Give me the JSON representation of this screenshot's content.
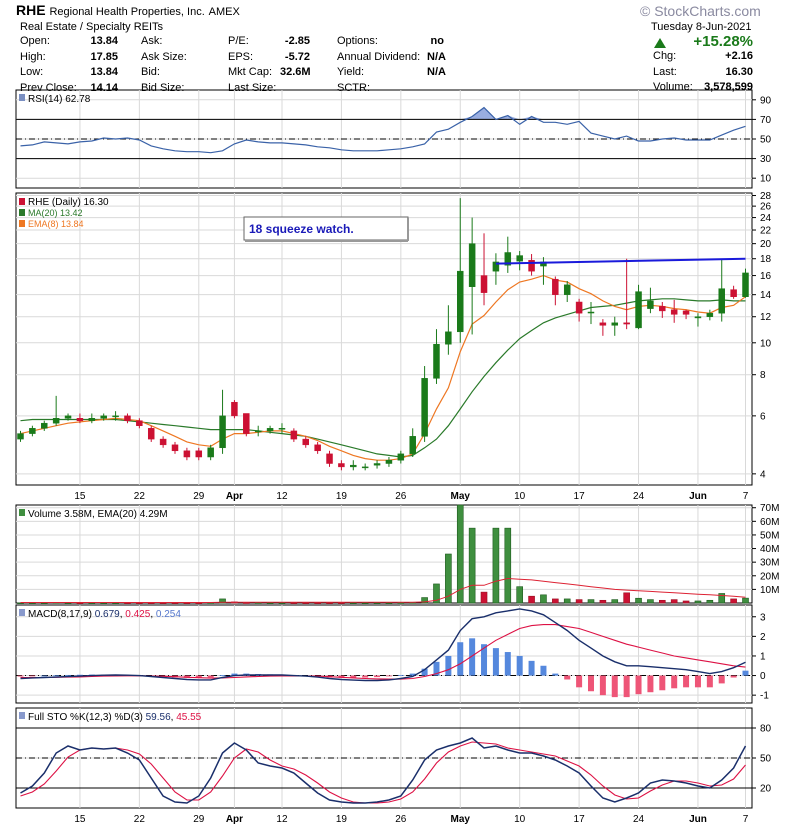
{
  "header": {
    "symbol": "RHE",
    "company": "Regional Health Properties, Inc.",
    "exchange": "AMEX",
    "sector": "Real Estate / Specialty REITs",
    "date": "Tuesday  8-Jun-2021",
    "watermark": "© StockCharts.com",
    "pct_change": "+15.28%",
    "rows_left": [
      {
        "label": "Open:",
        "value": "13.84"
      },
      {
        "label": "High:",
        "value": "17.85"
      },
      {
        "label": "Low:",
        "value": "13.84"
      },
      {
        "label": "Prev Close:",
        "value": "14.14"
      }
    ],
    "rows_mid1": [
      {
        "label": "Ask:",
        "value": ""
      },
      {
        "label": "Ask Size:",
        "value": ""
      },
      {
        "label": "Bid:",
        "value": ""
      },
      {
        "label": "Bid Size:",
        "value": ""
      }
    ],
    "rows_mid2": [
      {
        "label": "P/E:",
        "value": "-2.85"
      },
      {
        "label": "EPS:",
        "value": "-5.72"
      },
      {
        "label": "Mkt Cap:",
        "value": "32.6M"
      },
      {
        "label": "Last Size:",
        "value": ""
      }
    ],
    "rows_mid3": [
      {
        "label": "Options:",
        "value": "no"
      },
      {
        "label": "Annual Dividend:",
        "value": "N/A"
      },
      {
        "label": "Yield:",
        "value": "N/A"
      },
      {
        "label": "SCTR:",
        "value": ""
      }
    ],
    "rows_right": [
      {
        "label": "Chg:",
        "value": "+2.16"
      },
      {
        "label": "Last:",
        "value": "16.30"
      },
      {
        "label": "Volume:",
        "value": "3,578,599"
      }
    ]
  },
  "chart_data": {
    "type": "candlestick",
    "x_labels": [
      {
        "i": 5,
        "text": "15"
      },
      {
        "i": 10,
        "text": "22"
      },
      {
        "i": 15,
        "text": "29"
      },
      {
        "i": 18,
        "text": "Apr"
      },
      {
        "i": 22,
        "text": "12"
      },
      {
        "i": 27,
        "text": "19"
      },
      {
        "i": 32,
        "text": "26"
      },
      {
        "i": 37,
        "text": "May"
      },
      {
        "i": 42,
        "text": "10"
      },
      {
        "i": 47,
        "text": "17"
      },
      {
        "i": 52,
        "text": "24"
      },
      {
        "i": 57,
        "text": "Jun"
      },
      {
        "i": 61,
        "text": "7"
      }
    ],
    "colors": {
      "up": "#1a7a1a",
      "down": "#cc1133",
      "ma": "#2a7a2a",
      "ema": "#ee7722",
      "rsi": "#3a62a8",
      "macd": "#1a2f6b",
      "signal": "#dd1144",
      "hist": "#5588dd",
      "trend": "#1a1adb",
      "vol": "#3f8f3f",
      "vol_ema": "#dd2233"
    },
    "rsi": {
      "legend": "RSI(14)",
      "legend_value": "62.78",
      "ylim": [
        0,
        100
      ],
      "ticks": [
        10,
        30,
        50,
        70,
        90
      ],
      "levels": [
        30,
        50,
        70
      ],
      "values": [
        43,
        44,
        47,
        46,
        45,
        47,
        48,
        51,
        50,
        51,
        49,
        43,
        40,
        38,
        37,
        37,
        36,
        38,
        45,
        49,
        47,
        46,
        46,
        45,
        44,
        42,
        41,
        39,
        38,
        38,
        38,
        39,
        40,
        42,
        45,
        57,
        60,
        67,
        73,
        82,
        70,
        74,
        65,
        73,
        67,
        67,
        65,
        68,
        56,
        53,
        50,
        53,
        48,
        48,
        50,
        51,
        49,
        49,
        49,
        54,
        59,
        63
      ]
    },
    "price": {
      "legend": "RHE (Daily)",
      "legend_value": "16.30",
      "ma_legend": "MA(20)",
      "ma_value": "13.42",
      "ema_legend": "EMA(8)",
      "ema_value": "13.84",
      "annotation": "18 squeeze watch.",
      "scale": "log",
      "ylim": [
        3.7,
        28.5
      ],
      "ticks": [
        4,
        6,
        8,
        10,
        12,
        14,
        16,
        18,
        20,
        22,
        24,
        26,
        28
      ],
      "trendline": {
        "from": [
          40,
          17.4
        ],
        "to": [
          61,
          18.0
        ]
      },
      "open": [
        5.1,
        5.3,
        5.5,
        5.7,
        5.9,
        5.9,
        5.8,
        5.9,
        6.0,
        6.0,
        5.8,
        5.5,
        5.1,
        4.9,
        4.7,
        4.7,
        4.5,
        4.8,
        6.6,
        6.1,
        5.4,
        5.4,
        5.5,
        5.4,
        5.1,
        4.9,
        4.6,
        4.3,
        4.2,
        4.2,
        4.25,
        4.3,
        4.4,
        4.6,
        5.2,
        7.8,
        9.9,
        10.8,
        14.8,
        16.0,
        16.5,
        17.2,
        17.7,
        17.8,
        17.1,
        15.6,
        14.0,
        13.3,
        12.4,
        11.5,
        11.3,
        11.5,
        11.1,
        12.7,
        12.9,
        12.6,
        12.5,
        11.9,
        12.0,
        12.3,
        14.5,
        13.8
      ],
      "close": [
        5.3,
        5.5,
        5.7,
        5.9,
        6.0,
        5.8,
        5.9,
        6.0,
        6.0,
        5.8,
        5.6,
        5.1,
        4.9,
        4.7,
        4.5,
        4.5,
        4.8,
        6.0,
        6.0,
        5.3,
        5.4,
        5.5,
        5.5,
        5.1,
        4.9,
        4.7,
        4.3,
        4.2,
        4.25,
        4.2,
        4.3,
        4.4,
        4.6,
        5.2,
        7.8,
        9.9,
        10.8,
        16.5,
        20.0,
        14.2,
        17.6,
        18.8,
        18.4,
        16.5,
        17.6,
        14.0,
        15.0,
        12.3,
        12.4,
        11.3,
        11.5,
        11.4,
        14.3,
        13.4,
        12.5,
        12.2,
        12.2,
        12.0,
        12.3,
        14.6,
        13.8,
        16.3
      ],
      "high": [
        5.4,
        5.6,
        5.8,
        6.9,
        6.1,
        6.1,
        6.1,
        6.1,
        6.2,
        6.1,
        5.9,
        5.6,
        5.2,
        5.0,
        4.8,
        4.8,
        4.9,
        7.2,
        6.7,
        6.1,
        5.6,
        5.6,
        5.7,
        5.5,
        5.2,
        5.0,
        4.7,
        4.4,
        4.4,
        4.3,
        4.4,
        4.5,
        4.7,
        5.5,
        8.5,
        11.0,
        13.0,
        27.5,
        24.0,
        21.5,
        18.7,
        21.0,
        19.0,
        18.6,
        18.2,
        15.9,
        15.4,
        13.6,
        13.3,
        11.8,
        12.0,
        18.0,
        15.0,
        14.7,
        13.3,
        13.5,
        12.6,
        12.3,
        12.6,
        18.0,
        14.9,
        16.8
      ],
      "low": [
        5.0,
        5.2,
        5.4,
        5.6,
        5.8,
        5.7,
        5.7,
        5.8,
        5.8,
        5.7,
        5.5,
        5.0,
        4.8,
        4.6,
        4.4,
        4.4,
        4.4,
        4.6,
        5.9,
        5.2,
        5.2,
        5.3,
        5.3,
        5.0,
        4.8,
        4.6,
        4.2,
        4.1,
        4.1,
        4.1,
        4.15,
        4.2,
        4.3,
        4.5,
        5.0,
        7.5,
        9.2,
        10.0,
        10.6,
        13.0,
        15.0,
        16.3,
        16.6,
        16.0,
        15.0,
        13.0,
        13.3,
        11.6,
        11.4,
        10.5,
        10.5,
        11.0,
        11.0,
        12.3,
        11.9,
        11.5,
        11.8,
        11.2,
        11.7,
        11.6,
        13.6,
        13.7
      ],
      "ma20": [
        5.8,
        5.85,
        5.85,
        5.85,
        5.85,
        5.85,
        5.85,
        5.85,
        5.85,
        5.8,
        5.75,
        5.7,
        5.65,
        5.6,
        5.55,
        5.5,
        5.45,
        5.45,
        5.45,
        5.45,
        5.4,
        5.35,
        5.3,
        5.25,
        5.2,
        5.1,
        5.0,
        4.9,
        4.8,
        4.7,
        4.6,
        4.55,
        4.5,
        4.55,
        4.8,
        5.1,
        5.6,
        6.3,
        7.1,
        7.9,
        8.7,
        9.5,
        10.3,
        10.9,
        11.5,
        11.9,
        12.2,
        12.5,
        12.8,
        12.9,
        13.0,
        13.2,
        13.4,
        13.5,
        13.6,
        13.6,
        13.5,
        13.4,
        13.4,
        13.5,
        13.4,
        13.4
      ],
      "ema8": [
        5.3,
        5.4,
        5.5,
        5.6,
        5.7,
        5.75,
        5.8,
        5.85,
        5.9,
        5.85,
        5.8,
        5.6,
        5.4,
        5.2,
        5.0,
        4.9,
        4.85,
        5.1,
        5.3,
        5.3,
        5.35,
        5.4,
        5.4,
        5.3,
        5.2,
        5.05,
        4.85,
        4.7,
        4.55,
        4.45,
        4.4,
        4.4,
        4.45,
        4.6,
        5.3,
        6.3,
        7.3,
        9.4,
        11.4,
        12.1,
        13.3,
        14.5,
        15.3,
        15.6,
        16.0,
        15.5,
        15.3,
        14.6,
        14.1,
        13.4,
        12.9,
        12.6,
        12.9,
        13.0,
        12.9,
        12.7,
        12.6,
        12.4,
        12.3,
        12.8,
        13.0,
        13.8
      ]
    },
    "volume": {
      "legend": "Volume",
      "legend_value": "3.58M",
      "ema_legend": "EMA(20)",
      "ema_value": "4.29M",
      "unit": "M",
      "ylim": [
        0,
        72
      ],
      "ticks": [
        "10M",
        "20M",
        "30M",
        "40M",
        "50M",
        "60M",
        "70M"
      ],
      "values": [
        0.1,
        0.1,
        0.1,
        0.3,
        0.1,
        0.1,
        0.1,
        0.1,
        0.1,
        0.1,
        0.1,
        0.1,
        0.1,
        0.1,
        0.1,
        0.1,
        0.2,
        3.0,
        0.8,
        0.2,
        0.2,
        0.1,
        0.1,
        0.1,
        0.1,
        0.1,
        0.1,
        0.1,
        0.1,
        0.1,
        0.1,
        0.1,
        0.2,
        0.3,
        4.0,
        14.0,
        36.0,
        72.0,
        55.0,
        8.0,
        55.0,
        55.0,
        12.0,
        5.0,
        6.0,
        3.0,
        3.0,
        2.5,
        2.5,
        2.0,
        2.5,
        7.5,
        3.5,
        2.5,
        2.0,
        2.5,
        1.5,
        1.5,
        2.0,
        7.0,
        3.0,
        3.58
      ],
      "ema": [
        0.4,
        0.4,
        0.4,
        0.4,
        0.4,
        0.4,
        0.4,
        0.4,
        0.4,
        0.4,
        0.4,
        0.4,
        0.4,
        0.4,
        0.4,
        0.4,
        0.4,
        0.6,
        0.6,
        0.6,
        0.6,
        0.6,
        0.6,
        0.6,
        0.6,
        0.6,
        0.6,
        0.6,
        0.6,
        0.6,
        0.5,
        0.5,
        0.5,
        0.5,
        0.8,
        2.0,
        5.0,
        10.0,
        13.0,
        13.0,
        16.0,
        18.0,
        17.5,
        17.0,
        16.0,
        15.0,
        14.0,
        13.0,
        12.0,
        11.0,
        10.0,
        9.5,
        9.0,
        8.5,
        8.0,
        7.5,
        7.0,
        6.5,
        6.0,
        5.5,
        5.0,
        4.29
      ]
    },
    "macd": {
      "legend": "MACD(8,17,9)",
      "macd_value": "0.679",
      "signal_value": "0.425",
      "hist_value": "0.254",
      "ylim": [
        -1.4,
        3.6
      ],
      "ticks": [
        -1,
        0,
        1,
        2,
        3
      ],
      "macd": [
        -0.15,
        -0.12,
        -0.1,
        -0.08,
        -0.05,
        -0.03,
        0,
        0.02,
        0.03,
        0.02,
        0,
        -0.05,
        -0.1,
        -0.15,
        -0.2,
        -0.22,
        -0.22,
        -0.1,
        0,
        0.03,
        0.03,
        0.03,
        0.03,
        0,
        -0.03,
        -0.08,
        -0.15,
        -0.2,
        -0.23,
        -0.25,
        -0.25,
        -0.22,
        -0.15,
        -0.05,
        0.3,
        0.8,
        1.3,
        2.3,
        2.9,
        3.0,
        3.2,
        3.3,
        3.4,
        3.3,
        3.1,
        2.7,
        2.3,
        1.8,
        1.4,
        1.0,
        0.7,
        0.5,
        0.5,
        0.45,
        0.4,
        0.35,
        0.3,
        0.2,
        0.1,
        0.2,
        0.4,
        0.68
      ],
      "signal": [
        -0.1,
        -0.1,
        -0.1,
        -0.09,
        -0.08,
        -0.07,
        -0.05,
        -0.03,
        -0.02,
        -0.01,
        -0.01,
        -0.02,
        -0.04,
        -0.06,
        -0.09,
        -0.11,
        -0.13,
        -0.12,
        -0.1,
        -0.07,
        -0.05,
        -0.03,
        -0.02,
        -0.02,
        -0.02,
        -0.03,
        -0.06,
        -0.09,
        -0.12,
        -0.15,
        -0.17,
        -0.18,
        -0.18,
        -0.15,
        -0.05,
        0.1,
        0.3,
        0.6,
        1.0,
        1.4,
        1.8,
        2.1,
        2.4,
        2.55,
        2.6,
        2.6,
        2.5,
        2.4,
        2.2,
        2.0,
        1.8,
        1.6,
        1.45,
        1.3,
        1.15,
        1.0,
        0.9,
        0.8,
        0.7,
        0.6,
        0.5,
        0.43
      ],
      "hist": [
        -0.05,
        -0.02,
        0,
        0.01,
        0.03,
        0.04,
        0.05,
        0.05,
        0.05,
        0.03,
        0.01,
        -0.03,
        -0.06,
        -0.09,
        -0.11,
        -0.11,
        -0.09,
        0.02,
        0.1,
        0.1,
        0.08,
        0.06,
        0.05,
        0.02,
        -0.01,
        -0.05,
        -0.09,
        -0.11,
        -0.11,
        -0.1,
        -0.08,
        -0.04,
        0.03,
        0.1,
        0.35,
        0.7,
        1.0,
        1.7,
        1.9,
        1.6,
        1.4,
        1.2,
        1.0,
        0.75,
        0.5,
        0.1,
        -0.2,
        -0.6,
        -0.8,
        -1.0,
        -1.1,
        -1.1,
        -0.95,
        -0.85,
        -0.75,
        -0.65,
        -0.6,
        -0.6,
        -0.6,
        -0.4,
        -0.1,
        0.25
      ]
    },
    "sto": {
      "legend": "Full STO %K(12,3) %D(3)",
      "k_value": "59.56",
      "d_value": "45.55",
      "ylim": [
        0,
        100
      ],
      "ticks": [
        20,
        50,
        80
      ],
      "levels": [
        20,
        50,
        80
      ],
      "k": [
        15,
        22,
        35,
        55,
        62,
        58,
        60,
        59,
        60,
        55,
        48,
        30,
        12,
        6,
        5,
        12,
        30,
        55,
        65,
        58,
        45,
        42,
        40,
        35,
        25,
        15,
        8,
        6,
        5,
        5,
        6,
        8,
        12,
        28,
        48,
        58,
        62,
        65,
        70,
        60,
        62,
        58,
        55,
        55,
        52,
        48,
        42,
        35,
        22,
        10,
        6,
        10,
        15,
        25,
        28,
        27,
        25,
        22,
        20,
        28,
        40,
        62
      ],
      "d": [
        12,
        16,
        24,
        37,
        51,
        58,
        60,
        59,
        60,
        58,
        54,
        44,
        30,
        16,
        8,
        8,
        16,
        32,
        50,
        59,
        56,
        48,
        42,
        39,
        33,
        25,
        16,
        10,
        6,
        5,
        5,
        6,
        9,
        16,
        29,
        45,
        56,
        62,
        66,
        65,
        64,
        60,
        58,
        56,
        54,
        52,
        47,
        42,
        33,
        22,
        13,
        9,
        10,
        17,
        23,
        27,
        27,
        25,
        22,
        23,
        29,
        43
      ]
    }
  }
}
